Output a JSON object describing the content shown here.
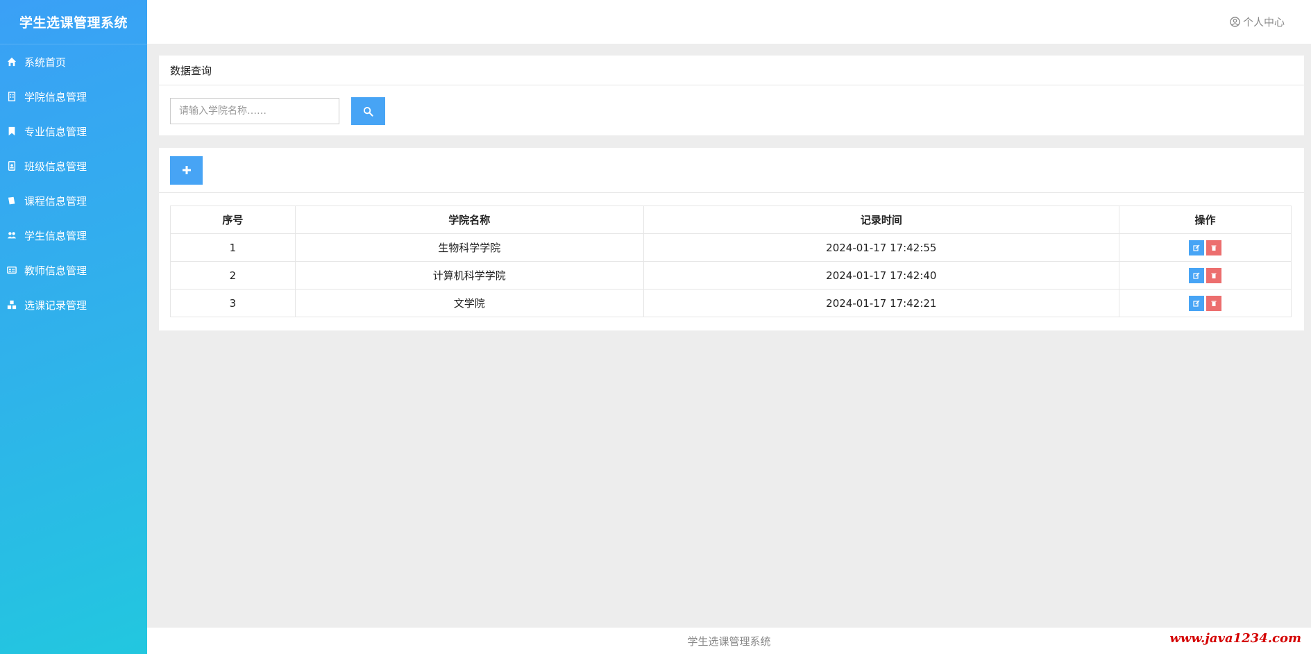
{
  "app": {
    "title": "学生选课管理系统"
  },
  "sidebar": {
    "items": [
      {
        "label": "系统首页",
        "icon": "home-icon"
      },
      {
        "label": "学院信息管理",
        "icon": "building-icon"
      },
      {
        "label": "专业信息管理",
        "icon": "bookmark-icon"
      },
      {
        "label": "班级信息管理",
        "icon": "id-badge-icon"
      },
      {
        "label": "课程信息管理",
        "icon": "book-icon"
      },
      {
        "label": "学生信息管理",
        "icon": "users-icon"
      },
      {
        "label": "教师信息管理",
        "icon": "id-card-icon"
      },
      {
        "label": "选课记录管理",
        "icon": "cubes-icon"
      }
    ]
  },
  "header": {
    "profile_label": "个人中心"
  },
  "query": {
    "title": "数据查询",
    "search_placeholder": "请输入学院名称……",
    "search_value": ""
  },
  "table": {
    "columns": [
      "序号",
      "学院名称",
      "记录时间",
      "操作"
    ],
    "rows": [
      {
        "index": "1",
        "name": "生物科学学院",
        "time": "2024-01-17 17:42:55"
      },
      {
        "index": "2",
        "name": "计算机科学学院",
        "time": "2024-01-17 17:42:40"
      },
      {
        "index": "3",
        "name": "文学院",
        "time": "2024-01-17 17:42:21"
      }
    ]
  },
  "footer": {
    "text": "学生选课管理系统"
  },
  "watermark": {
    "text": "www.java1234.com"
  },
  "colors": {
    "primary": "#47a4f5",
    "danger": "#ec6e6e",
    "sidebar_top": "#3aa0f6",
    "sidebar_bottom": "#22c7df"
  }
}
